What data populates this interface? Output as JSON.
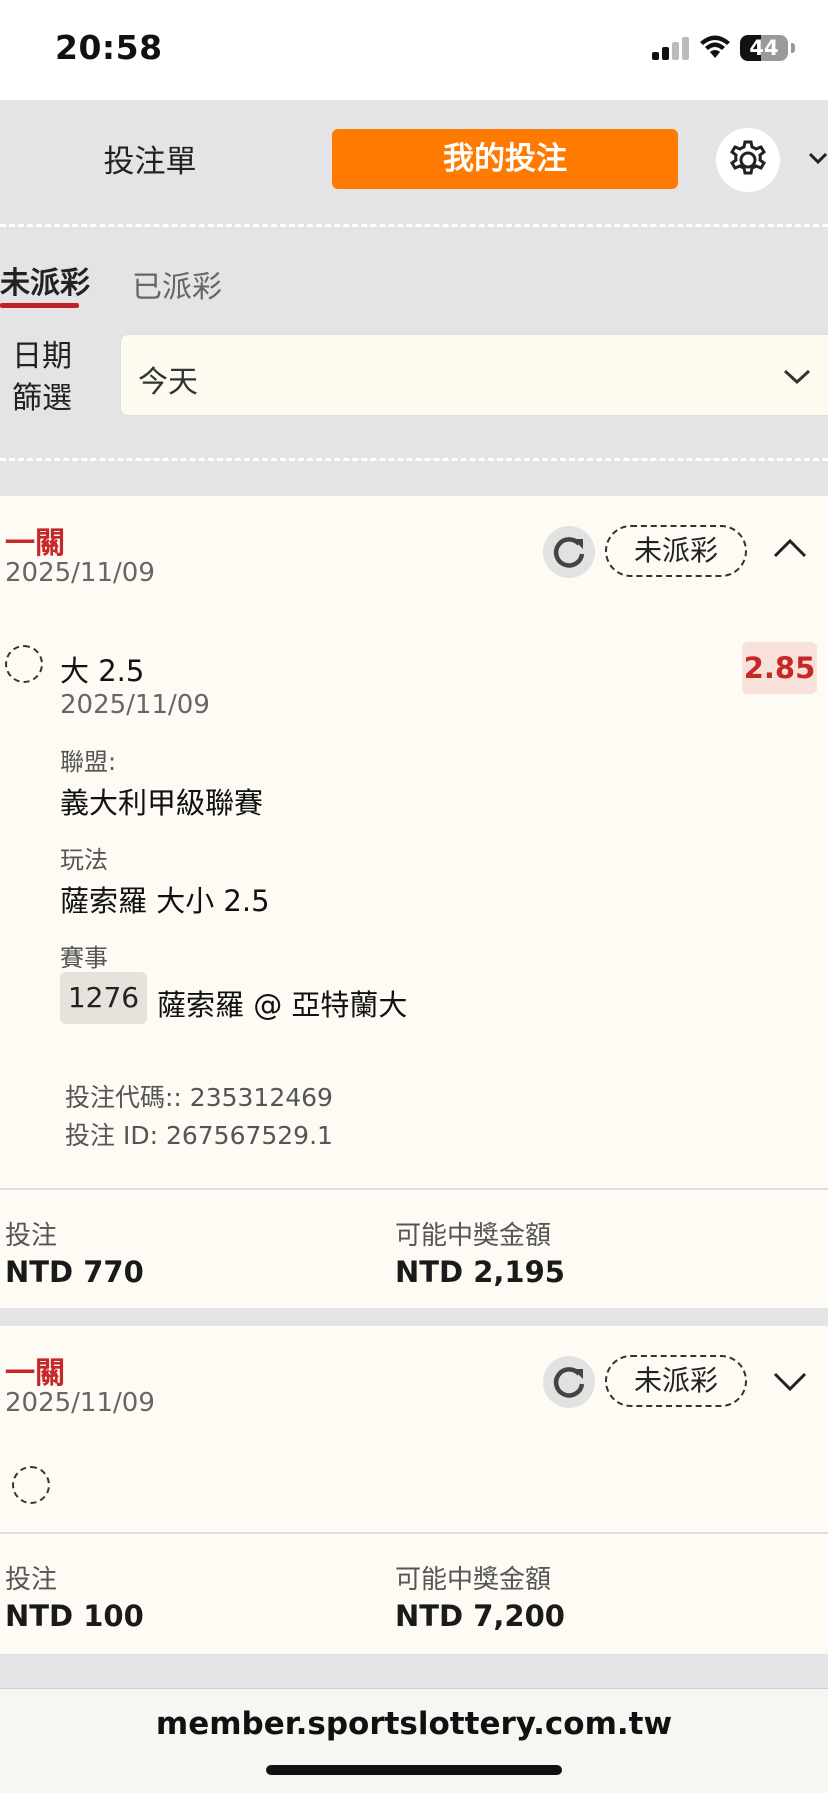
{
  "status_bar": {
    "time": "20:58",
    "battery": "44",
    "battery_level": 0.44,
    "icons": [
      "cellular-signal-icon",
      "wifi-icon",
      "battery-icon"
    ]
  },
  "top_tabs": {
    "bet_slip": "投注單",
    "my_bets": "我的投注",
    "accent_color": "#ff7a00",
    "settings_icon": "gear-icon",
    "collapse_icon": "chevron-down-icon"
  },
  "sub_tabs": {
    "unsettled": "未派彩",
    "settled": "已派彩",
    "active_color": "#c0202a"
  },
  "date_filter": {
    "label_line1": "日期",
    "label_line2": "篩選",
    "selected": "今天"
  },
  "bets": [
    {
      "type": "一關",
      "date": "2025/11/09",
      "status": "未派彩",
      "expanded": true,
      "selection": {
        "name": "大 2.5",
        "date": "2025/11/09",
        "odds": "2.85",
        "league_label": "聯盟:",
        "league": "義大利甲級聯賽",
        "market_label": "玩法",
        "market": "薩索羅 大小 2.5",
        "event_label": "賽事",
        "event_code": "1276",
        "event": "薩索羅 @ 亞特蘭大"
      },
      "bet_code": "投注代碼:: 235312469",
      "bet_id": "投注 ID: 267567529.1",
      "stake_label": "投注",
      "stake": "NTD 770",
      "payout_label": "可能中獎金額",
      "payout": "NTD 2,195"
    },
    {
      "type": "一關",
      "date": "2025/11/09",
      "status": "未派彩",
      "expanded": false,
      "stake_label": "投注",
      "stake": "NTD 100",
      "payout_label": "可能中獎金額",
      "payout": "NTD 7,200"
    }
  ],
  "browser": {
    "url": "member.sportslottery.com.tw"
  }
}
